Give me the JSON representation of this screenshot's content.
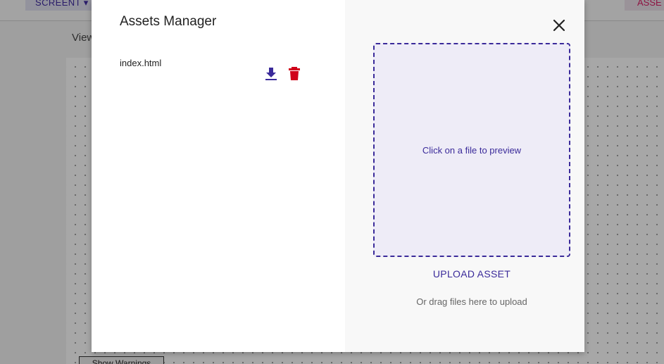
{
  "background": {
    "screen_button": "SCREENT ▾",
    "assets_button": "ASSETS",
    "view_label": "View",
    "warnings_button": "Show Warnings"
  },
  "modal": {
    "title": "Assets Manager",
    "assets": [
      {
        "name": "index.html"
      }
    ],
    "close_icon": "close-icon",
    "download_icon": "download-icon",
    "delete_icon": "trash-icon",
    "preview_text": "Click on a file to preview",
    "upload_label": "UPLOAD ASSET",
    "drag_hint": "Or drag files here to upload"
  },
  "colors": {
    "accent": "#3a2a9a",
    "danger": "#d0021b",
    "dropzone_bg": "#eeecf7"
  }
}
